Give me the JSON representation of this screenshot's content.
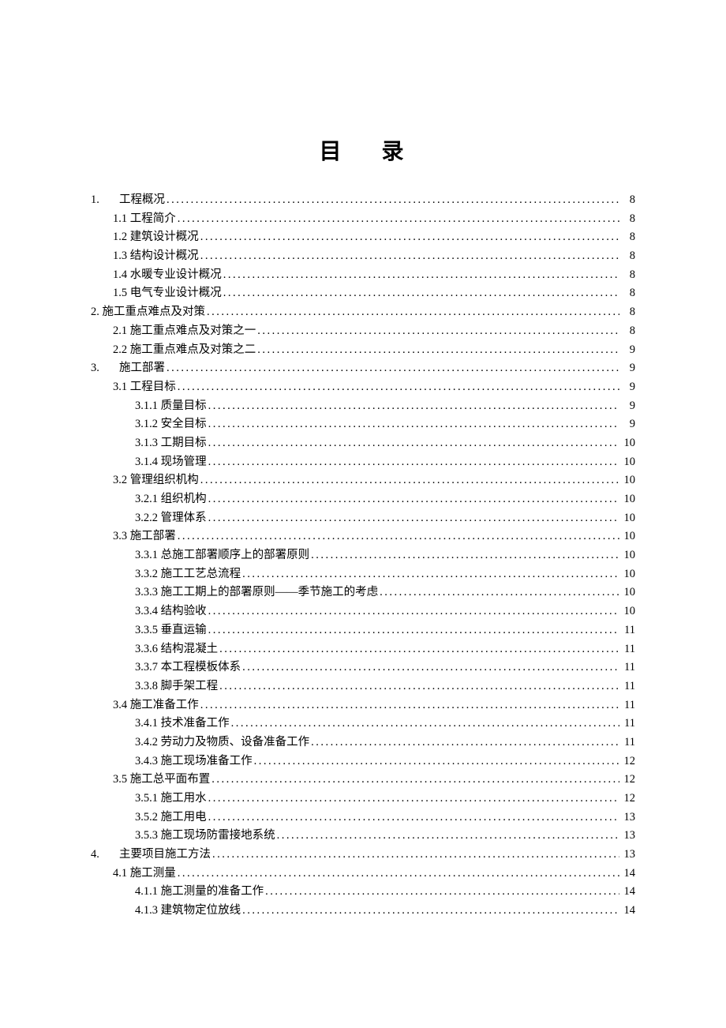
{
  "title": "目 录",
  "entries": [
    {
      "level": 0,
      "num": "1.",
      "label": "工程概况",
      "page": "8"
    },
    {
      "level": 1,
      "num": "",
      "label": "1.1 工程简介",
      "page": "8"
    },
    {
      "level": 1,
      "num": "",
      "label": "1.2 建筑设计概况",
      "page": "8"
    },
    {
      "level": 1,
      "num": "",
      "label": "1.3 结构设计概况",
      "page": "8"
    },
    {
      "level": 1,
      "num": "",
      "label": "1.4 水暖专业设计概况",
      "page": "8"
    },
    {
      "level": 1,
      "num": "",
      "label": "1.5 电气专业设计概况",
      "page": "8"
    },
    {
      "level": 0,
      "num": "",
      "label": "2. 施工重点难点及对策",
      "page": "8"
    },
    {
      "level": 1,
      "num": "",
      "label": "2.1 施工重点难点及对策之一",
      "page": "8"
    },
    {
      "level": 1,
      "num": "",
      "label": "2.2 施工重点难点及对策之二",
      "page": "9"
    },
    {
      "level": 0,
      "num": "3.",
      "label": "施工部署",
      "page": "9"
    },
    {
      "level": 1,
      "num": "",
      "label": "3.1 工程目标",
      "page": "9"
    },
    {
      "level": 2,
      "num": "",
      "label": "3.1.1 质量目标",
      "page": "9"
    },
    {
      "level": 2,
      "num": "",
      "label": "3.1.2 安全目标",
      "page": "9"
    },
    {
      "level": 2,
      "num": "",
      "label": "3.1.3 工期目标",
      "page": "10"
    },
    {
      "level": 2,
      "num": "",
      "label": "3.1.4 现场管理",
      "page": "10"
    },
    {
      "level": 1,
      "num": "",
      "label": "3.2 管理组织机构",
      "page": "10"
    },
    {
      "level": 2,
      "num": "",
      "label": "3.2.1 组织机构",
      "page": "10"
    },
    {
      "level": 2,
      "num": "",
      "label": "3.2.2 管理体系",
      "page": "10"
    },
    {
      "level": 1,
      "num": "",
      "label": "3.3 施工部署",
      "page": "10"
    },
    {
      "level": 2,
      "num": "",
      "label": "3.3.1 总施工部署顺序上的部署原则",
      "page": "10"
    },
    {
      "level": 2,
      "num": "",
      "label": "3.3.2 施工工艺总流程",
      "page": "10"
    },
    {
      "level": 2,
      "num": "",
      "label": "3.3.3 施工工期上的部署原则——季节施工的考虑",
      "page": "10"
    },
    {
      "level": 2,
      "num": "",
      "label": "3.3.4 结构验收",
      "page": "10"
    },
    {
      "level": 2,
      "num": "",
      "label": "3.3.5 垂直运输",
      "page": "11"
    },
    {
      "level": 2,
      "num": "",
      "label": "3.3.6 结构混凝土",
      "page": "11"
    },
    {
      "level": 2,
      "num": "",
      "label": "3.3.7 本工程模板体系",
      "page": "11"
    },
    {
      "level": 2,
      "num": "",
      "label": "3.3.8 脚手架工程",
      "page": "11"
    },
    {
      "level": 1,
      "num": "",
      "label": "3.4 施工准备工作",
      "page": "11"
    },
    {
      "level": 2,
      "num": "",
      "label": "3.4.1 技术准备工作",
      "page": "11"
    },
    {
      "level": 2,
      "num": "",
      "label": "3.4.2 劳动力及物质、设备准备工作",
      "page": "11"
    },
    {
      "level": 2,
      "num": "",
      "label": "3.4.3 施工现场准备工作",
      "page": "12"
    },
    {
      "level": 1,
      "num": "",
      "label": "3.5 施工总平面布置",
      "page": "12"
    },
    {
      "level": 2,
      "num": "",
      "label": "3.5.1 施工用水",
      "page": "12"
    },
    {
      "level": 2,
      "num": "",
      "label": "3.5.2 施工用电",
      "page": "13"
    },
    {
      "level": 2,
      "num": "",
      "label": "3.5.3 施工现场防雷接地系统",
      "page": "13"
    },
    {
      "level": 0,
      "num": "4.",
      "label": "主要项目施工方法",
      "page": "13"
    },
    {
      "level": 1,
      "num": "",
      "label": "4.1 施工测量",
      "page": "14"
    },
    {
      "level": 2,
      "num": "",
      "label": "4.1.1 施工测量的准备工作",
      "page": "14"
    },
    {
      "level": 2,
      "num": "",
      "label": "4.1.3 建筑物定位放线",
      "page": "14"
    }
  ]
}
